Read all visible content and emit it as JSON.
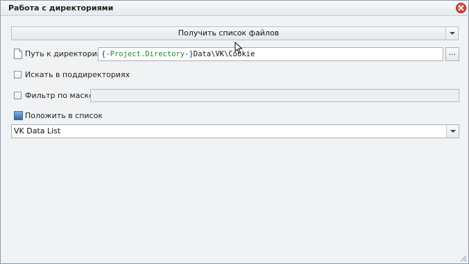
{
  "window": {
    "title": "Работа с директориями"
  },
  "action": {
    "selected": "Получить список файлов"
  },
  "directory": {
    "label": "Путь к директории",
    "value_var_open": "{-",
    "value_var_name": "Project.Directory",
    "value_var_close": "-}",
    "value_rest": "Data\\VK\\Cookie",
    "browse_label": "..."
  },
  "options": {
    "subdirs_label": "Искать в поддиректориях",
    "subdirs_checked": false,
    "filter_label": "Фильтр по маске",
    "filter_checked": false,
    "filter_value": "",
    "put_to_list_label": "Положить в список"
  },
  "target_list": {
    "selected": "VK Data List"
  },
  "icons": {
    "close": "close-icon",
    "file": "file-icon",
    "list": "list-icon",
    "dropdown": "chevron-down-icon",
    "resize": "resize-grip-icon"
  }
}
